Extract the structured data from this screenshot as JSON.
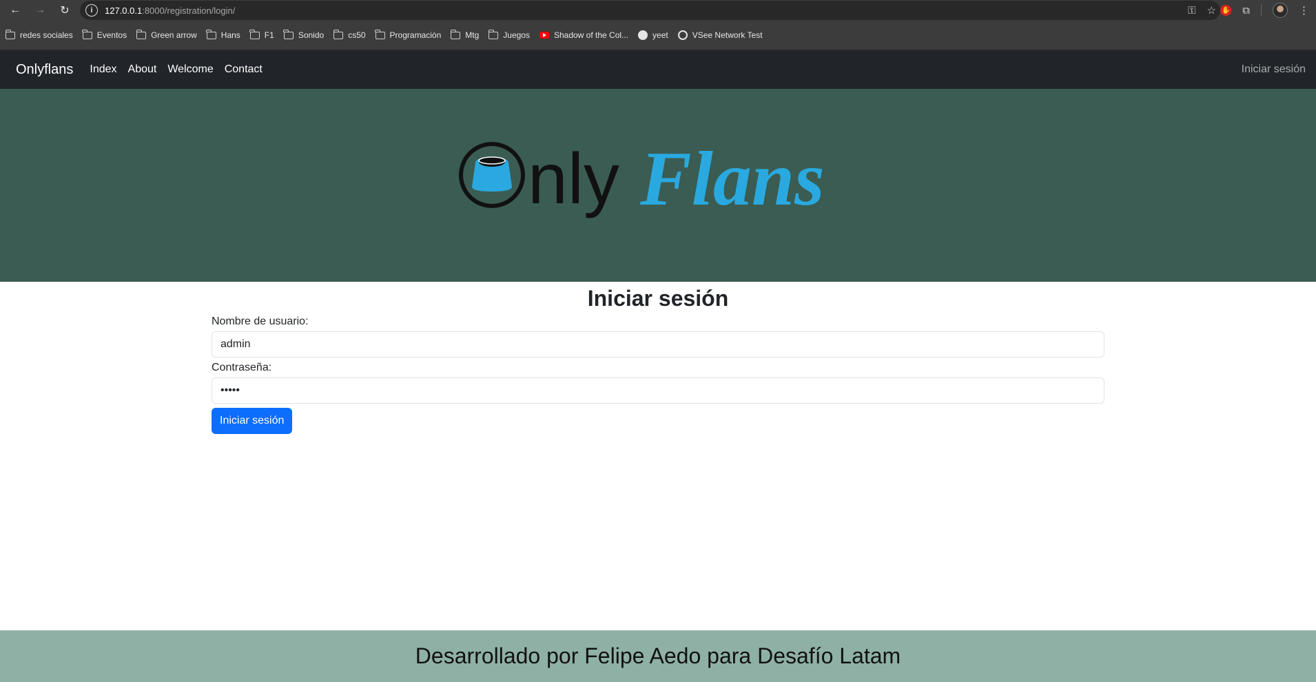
{
  "browser": {
    "url_host": "127.0.0.1",
    "url_rest": ":8000/registration/login/",
    "bookmarks": [
      {
        "label": "redes sociales",
        "icon": "folder-icon"
      },
      {
        "label": "Eventos",
        "icon": "folder-icon"
      },
      {
        "label": "Green arrow",
        "icon": "folder-icon"
      },
      {
        "label": "Hans",
        "icon": "folder-icon"
      },
      {
        "label": "F1",
        "icon": "folder-icon"
      },
      {
        "label": "Sonido",
        "icon": "folder-icon"
      },
      {
        "label": "cs50",
        "icon": "folder-icon"
      },
      {
        "label": "Programación",
        "icon": "folder-icon"
      },
      {
        "label": "Mtg",
        "icon": "folder-icon"
      },
      {
        "label": "Juegos",
        "icon": "folder-icon"
      },
      {
        "label": "Shadow of the Col...",
        "icon": "youtube-icon"
      },
      {
        "label": "yeet",
        "icon": "github-icon"
      },
      {
        "label": "VSee Network Test",
        "icon": "globe-icon"
      }
    ]
  },
  "navbar": {
    "brand": "Onlyflans",
    "links": [
      "Index",
      "About",
      "Welcome",
      "Contact"
    ],
    "login": "Iniciar sesión"
  },
  "hero": {
    "logo_part1": "nly",
    "logo_part2": "Flans",
    "colors": {
      "background": "#3b5c52",
      "accent": "#29a9df"
    }
  },
  "form": {
    "title": "Iniciar sesión",
    "username_label": "Nombre de usuario:",
    "username_value": "admin",
    "password_label": "Contraseña:",
    "password_value": "•••••",
    "submit_label": "Iniciar sesión"
  },
  "footer": {
    "text": "Desarrollado por Felipe Aedo para Desafío Latam"
  }
}
